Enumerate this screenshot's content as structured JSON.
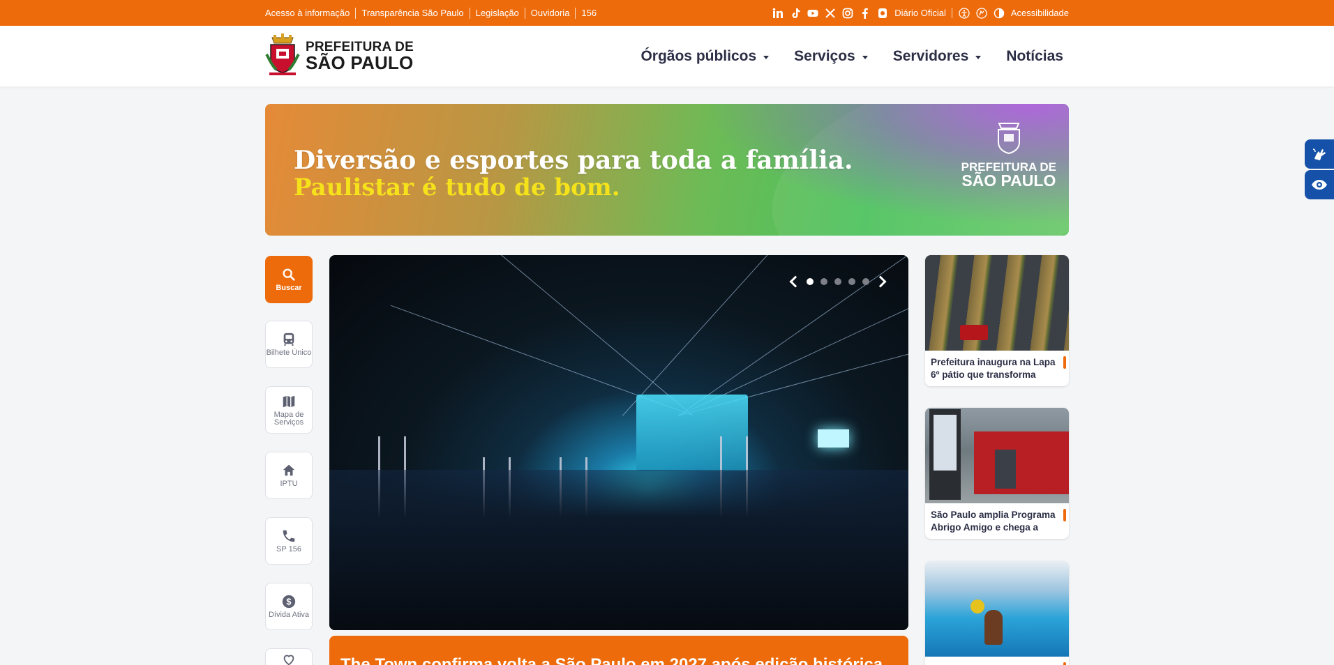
{
  "topbar": {
    "links": [
      "Acesso à informação",
      "Transparência São Paulo",
      "Legislação",
      "Ouvidoria",
      "156"
    ],
    "social_icons": [
      "linkedin-icon",
      "tiktok-icon",
      "youtube-icon",
      "x-icon",
      "instagram-icon",
      "facebook-icon",
      "app-icon"
    ],
    "diario_oficial": "Diário Oficial",
    "accessibility_icons": [
      "accessibility-icon",
      "sign-language-icon",
      "contrast-icon"
    ],
    "acessibilidade": "Acessibilidade",
    "color": "#ee6b0b"
  },
  "header": {
    "logo_line1": "PREFEITURA DE",
    "logo_line2": "SÃO PAULO",
    "nav": [
      {
        "label": "Órgãos públicos",
        "has_dropdown": true
      },
      {
        "label": "Serviços",
        "has_dropdown": true
      },
      {
        "label": "Servidores",
        "has_dropdown": true
      },
      {
        "label": "Notícias",
        "has_dropdown": false
      }
    ]
  },
  "banner": {
    "line1": "Diversão e esportes para toda a família.",
    "line2": "Paulistar é tudo de bom.",
    "logo_line1": "PREFEITURA DE",
    "logo_line2": "SÃO PAULO"
  },
  "quick_links": [
    {
      "label": "Buscar",
      "icon": "search-icon",
      "primary": true
    },
    {
      "label": "Bilhete Único",
      "icon": "bus-icon",
      "primary": false
    },
    {
      "label": "Mapa de Serviços",
      "icon": "map-icon",
      "primary": false
    },
    {
      "label": "IPTU",
      "icon": "home-icon",
      "primary": false
    },
    {
      "label": "SP 156",
      "icon": "phone-icon",
      "primary": false
    },
    {
      "label": "Dívida Ativa",
      "icon": "dollar-icon",
      "primary": false
    }
  ],
  "carousel": {
    "slide_count": 5,
    "active_index": 0,
    "caption": "The Town confirma volta a São Paulo em 2027 após edição histórica"
  },
  "news": [
    {
      "title": "Prefeitura inaugura na Lapa 6º pátio que transforma"
    },
    {
      "title": "São Paulo amplia Programa Abrigo Amigo e chega a"
    },
    {
      "title": ""
    }
  ]
}
